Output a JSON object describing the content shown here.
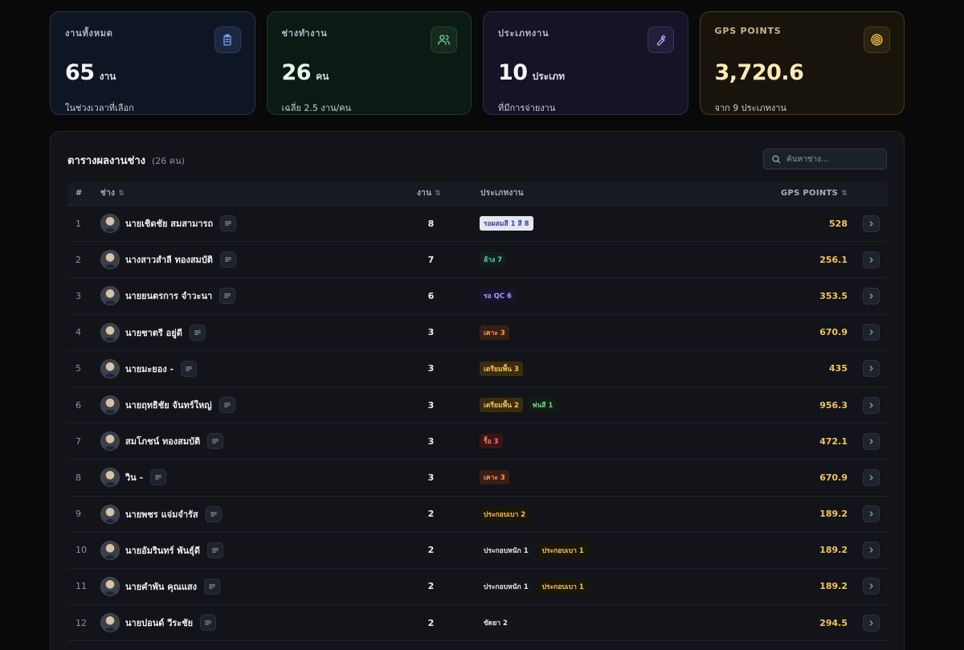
{
  "cards": [
    {
      "title": "งานทั้งหมด",
      "value": "65",
      "unit": "งาน",
      "sub": "ในช่วงเวลาที่เลือก",
      "icon": "clipboard-icon",
      "accent": "#7aa2f7"
    },
    {
      "title": "ช่างทำงาน",
      "value": "26",
      "unit": "คน",
      "sub": "เฉลี่ย 2.5 งาน/คน",
      "icon": "users-icon",
      "accent": "#6fcf97"
    },
    {
      "title": "ประเภทงาน",
      "value": "10",
      "unit": "ประเภท",
      "sub": "ที่มีการจ่ายงาน",
      "icon": "wrench-icon",
      "accent": "#b59cf5"
    },
    {
      "title": "GPS POINTS",
      "value": "3,720.6",
      "unit": "",
      "sub": "จาก 9 ประเภทงาน",
      "icon": "target-icon",
      "accent": "#f2c45a"
    }
  ],
  "panel": {
    "title": "ตารางผลงานช่าง",
    "count": "(26 คน)",
    "search_placeholder": "ค้นหาช่าง..."
  },
  "table": {
    "headers": {
      "index": "#",
      "name": "ช่าง",
      "count": "งาน",
      "types": "ประเภทงาน",
      "points": "GPS POINTS"
    },
    "rows": [
      {
        "index": "1",
        "name": "นายเชิดชัย สมสามารถ",
        "count": "8",
        "types": [
          {
            "label": "รอผสมสี 1 สี 8",
            "kind": "white"
          }
        ],
        "points": "528"
      },
      {
        "index": "2",
        "name": "นางสาวสำลี ทองสมบัติ",
        "count": "7",
        "types": [
          {
            "label": "ล้าง 7",
            "kind": "teal"
          }
        ],
        "points": "256.1"
      },
      {
        "index": "3",
        "name": "นายยนตรการ จำวะนา",
        "count": "6",
        "types": [
          {
            "label": "รอ QC 6",
            "kind": "purple"
          }
        ],
        "points": "353.5"
      },
      {
        "index": "4",
        "name": "นายชาตรี อยู่ดี",
        "count": "3",
        "types": [
          {
            "label": "เคาะ 3",
            "kind": "orange"
          }
        ],
        "points": "670.9"
      },
      {
        "index": "5",
        "name": "นายมะยอง -",
        "count": "3",
        "types": [
          {
            "label": "เตรียมพื้น 3",
            "kind": "amber"
          }
        ],
        "points": "435"
      },
      {
        "index": "6",
        "name": "นายฤทธิชัย จันทร์ใหญ่",
        "count": "3",
        "types": [
          {
            "label": "เตรียมพื้น 2",
            "kind": "amber"
          },
          {
            "label": "พ่นสี 1",
            "kind": "green"
          }
        ],
        "points": "956.3"
      },
      {
        "index": "7",
        "name": "สมโภชน์ ทองสมบัติ",
        "count": "3",
        "types": [
          {
            "label": "รื้อ 3",
            "kind": "red"
          }
        ],
        "points": "472.1"
      },
      {
        "index": "8",
        "name": "วิน -",
        "count": "3",
        "types": [
          {
            "label": "เคาะ 3",
            "kind": "orange"
          }
        ],
        "points": "670.9"
      },
      {
        "index": "9",
        "name": "นายพชร แจ่มจำรัส",
        "count": "2",
        "types": [
          {
            "label": "ประกอบเบา 2",
            "kind": "yellow"
          }
        ],
        "points": "189.2"
      },
      {
        "index": "10",
        "name": "นายอัมรินทร์ พันธุ์ดี",
        "count": "2",
        "types": [
          {
            "label": "ประกอบหนัก 1",
            "kind": "plain"
          },
          {
            "label": "ประกอบเบา 1",
            "kind": "yellow"
          }
        ],
        "points": "189.2"
      },
      {
        "index": "11",
        "name": "นายคำพัน คุณแสง",
        "count": "2",
        "types": [
          {
            "label": "ประกอบหนัก 1",
            "kind": "plain"
          },
          {
            "label": "ประกอบเบา 1",
            "kind": "yellow"
          }
        ],
        "points": "189.2"
      },
      {
        "index": "12",
        "name": "นายปอนด์ วีระชัย",
        "count": "2",
        "types": [
          {
            "label": "ขัดยา 2",
            "kind": "plain"
          }
        ],
        "points": "294.5"
      }
    ]
  },
  "badge_styles": {
    "white": {
      "bg": "#e6e8ee",
      "fg": "#3b46a8"
    },
    "teal": {
      "bg": "#0f1f1e",
      "fg": "#5ed0b8"
    },
    "purple": {
      "bg": "#15142a",
      "fg": "#a99bff"
    },
    "orange": {
      "bg": "#3a1e12",
      "fg": "#f19a5f"
    },
    "amber": {
      "bg": "#3b2c0f",
      "fg": "#f2c45a"
    },
    "green": {
      "bg": "#0f1d13",
      "fg": "#6fd38a"
    },
    "red": {
      "bg": "#3a1414",
      "fg": "#f07575"
    },
    "yellow": {
      "bg": "#1a1608",
      "fg": "#f2c45a"
    },
    "plain": {
      "bg": "#14161b",
      "fg": "#e6e8ee"
    }
  }
}
